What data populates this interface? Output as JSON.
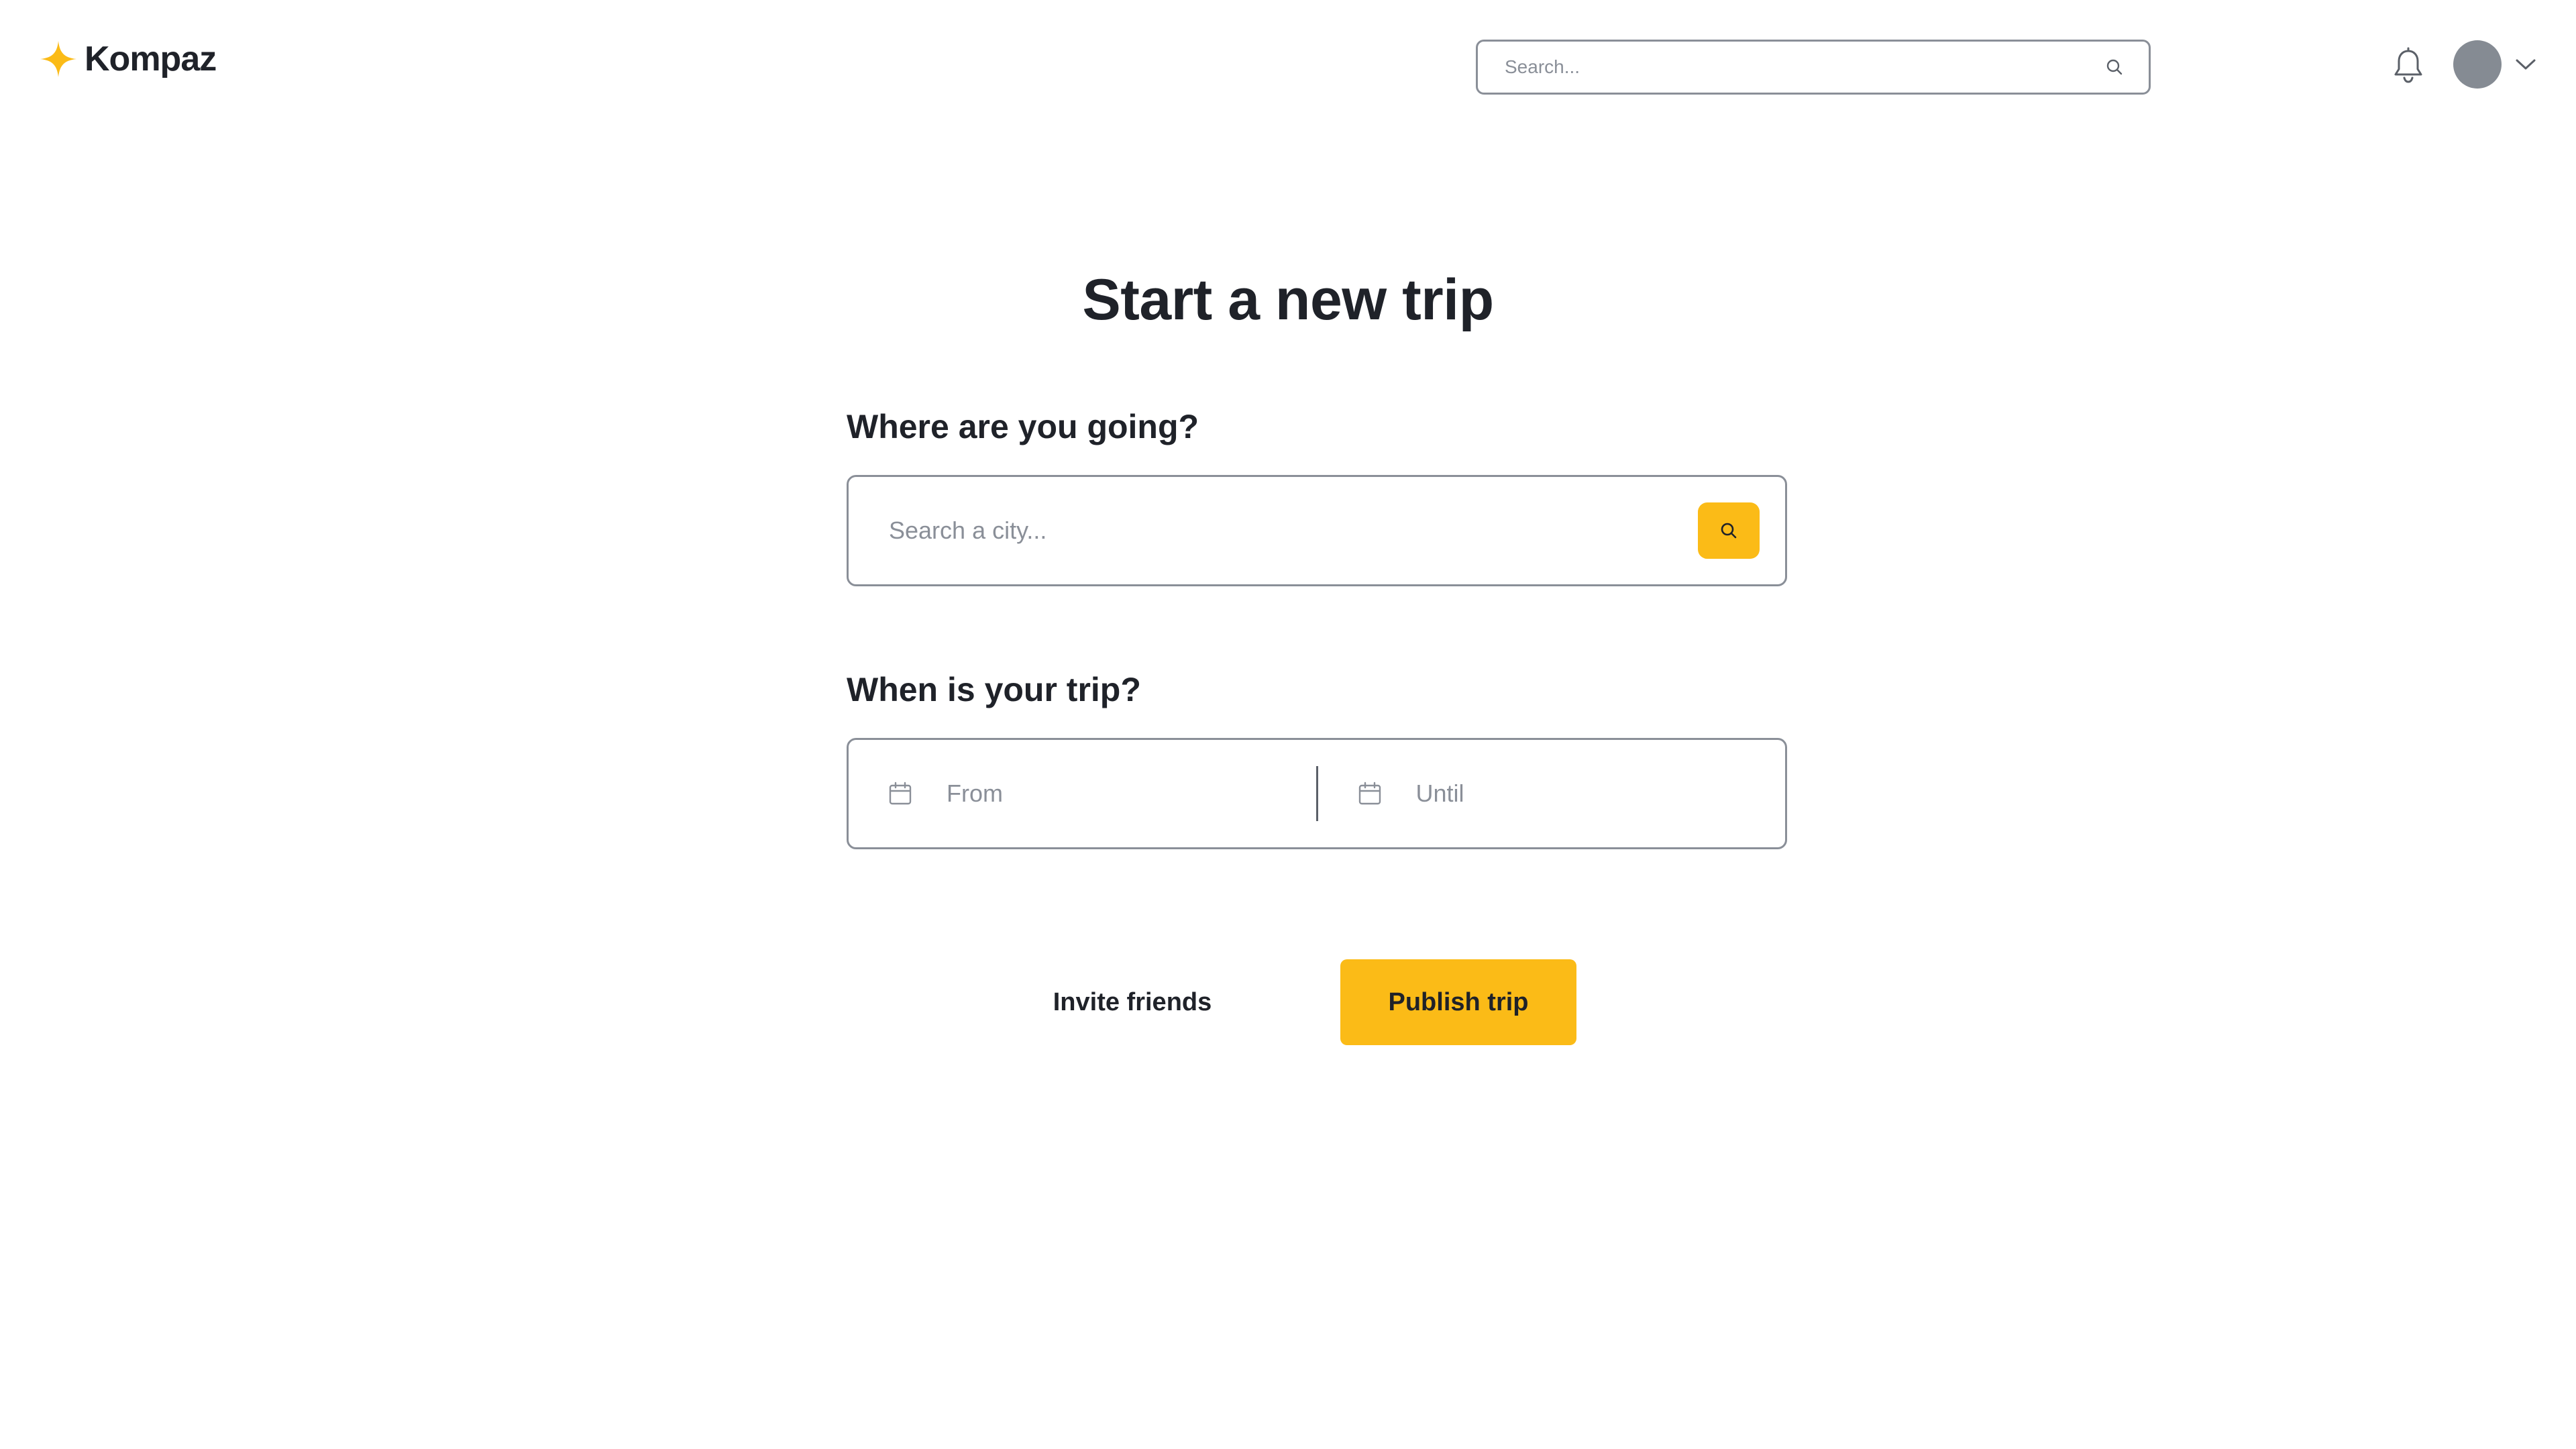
{
  "brand": {
    "name": "Kompaz",
    "accent_color": "#fbbb17",
    "logo_icon": "four-point-star-icon"
  },
  "header": {
    "search": {
      "placeholder": "Search...",
      "icon": "search-icon"
    },
    "notifications_icon": "bell-icon",
    "avatar_color": "#858b93",
    "account_menu_icon": "chevron-down-icon"
  },
  "main": {
    "title": "Start a new trip",
    "destination": {
      "label": "Where are you going?",
      "placeholder": "Search a city...",
      "button_icon": "search-icon"
    },
    "dates": {
      "label": "When is your trip?",
      "from_placeholder": "From",
      "until_placeholder": "Until",
      "icon": "calendar-icon"
    },
    "actions": {
      "invite_label": "Invite friends",
      "publish_label": "Publish trip"
    }
  }
}
